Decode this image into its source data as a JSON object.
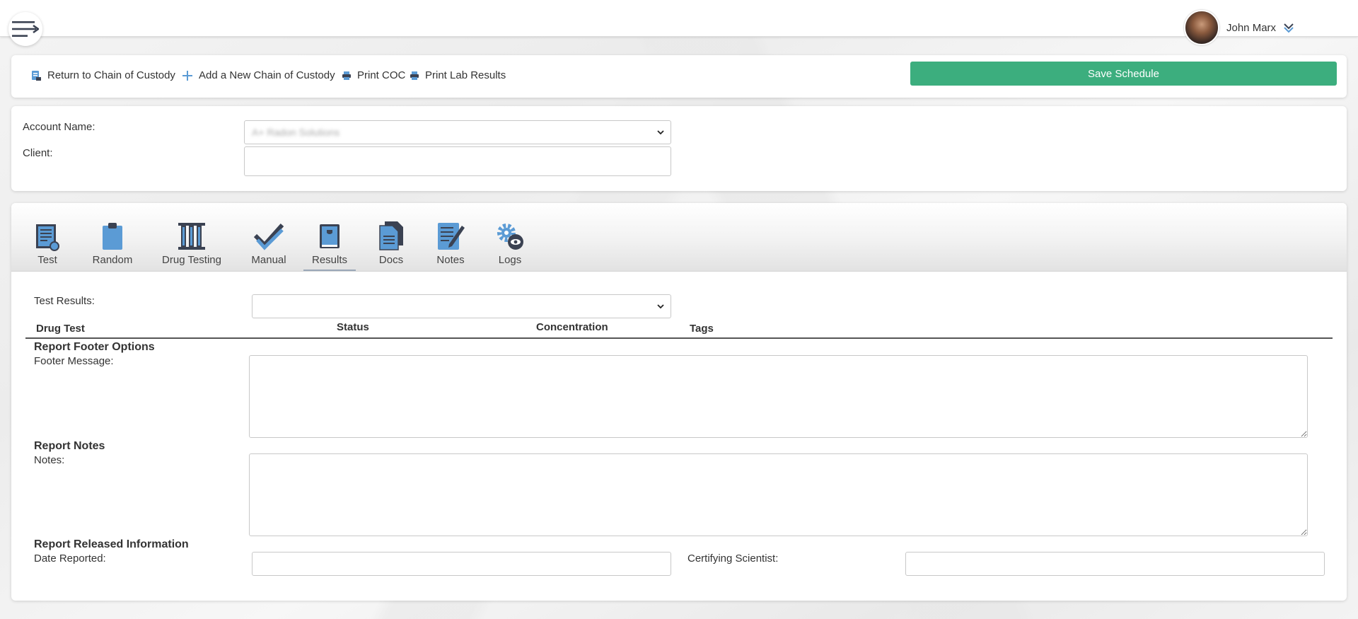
{
  "header": {
    "user_name": "John Marx"
  },
  "actions": {
    "return_label": "Return to Chain of Custody",
    "add_label": "Add a New Chain of Custody",
    "print_coc_label": "Print COC",
    "print_lab_label": "Print Lab Results",
    "save_label": "Save Schedule"
  },
  "account": {
    "account_name_label": "Account Name:",
    "account_name_value": "A+ Radon Solutions",
    "client_label": "Client:",
    "client_value": ""
  },
  "tabs": [
    {
      "label": "Test",
      "icon": "test-icon"
    },
    {
      "label": "Random",
      "icon": "clipboard-icon"
    },
    {
      "label": "Drug Testing",
      "icon": "test-tubes-icon"
    },
    {
      "label": "Manual",
      "icon": "checkmark-icon"
    },
    {
      "label": "Results",
      "icon": "book-icon",
      "active": true
    },
    {
      "label": "Docs",
      "icon": "documents-icon"
    },
    {
      "label": "Notes",
      "icon": "notepad-pencil-icon"
    },
    {
      "label": "Logs",
      "icon": "gear-eye-icon"
    }
  ],
  "results": {
    "test_results_label": "Test Results:",
    "test_results_value": "",
    "columns": [
      "Drug Test",
      "Status",
      "Concentration",
      "Tags"
    ],
    "footer_section_title": "Report Footer Options",
    "footer_message_label": "Footer Message:",
    "footer_message_value": "",
    "notes_section_title": "Report Notes",
    "notes_label": "Notes:",
    "notes_value": "",
    "released_section_title": "Report Released Information",
    "date_reported_label": "Date Reported:",
    "date_reported_value": "",
    "certifying_scientist_label": "Certifying Scientist:",
    "certifying_scientist_value": ""
  },
  "colors": {
    "save_button": "#3cae7e",
    "icon_blue": "#5b9bd5",
    "icon_dark": "#3b4252"
  }
}
